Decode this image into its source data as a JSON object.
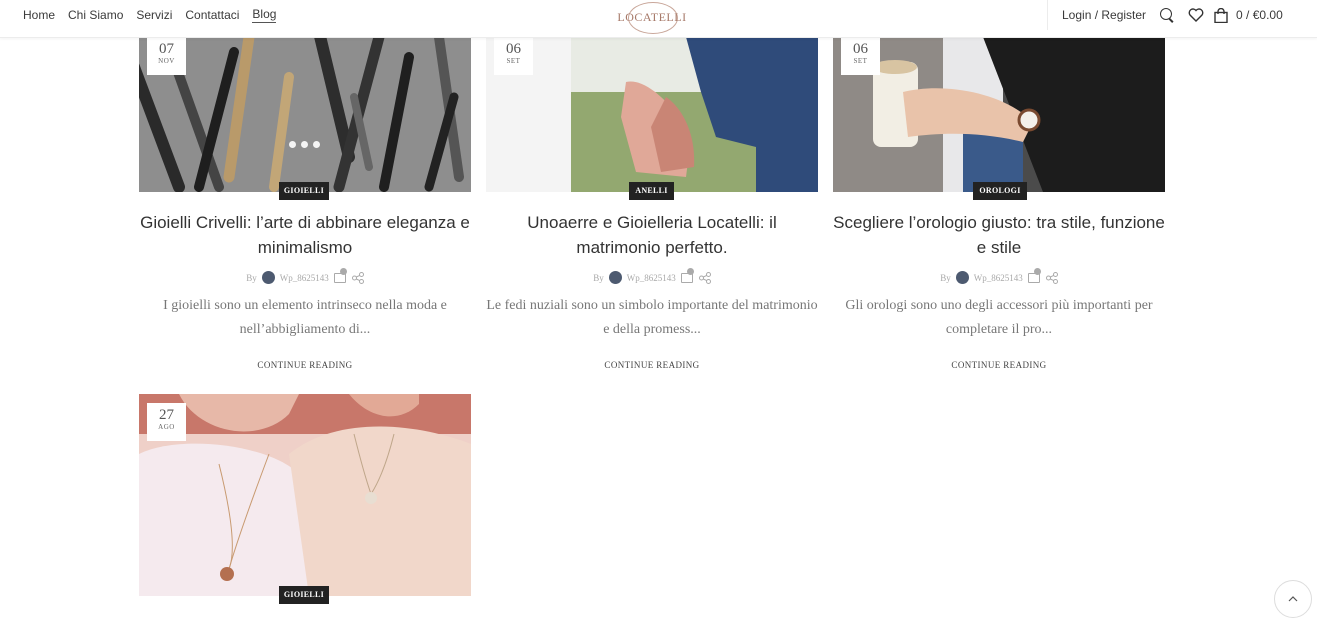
{
  "nav": {
    "items": [
      "Home",
      "Chi Siamo",
      "Servizi",
      "Contattaci",
      "Blog"
    ],
    "active": "Blog"
  },
  "logo": "LOCATELLI",
  "header_right": {
    "login": "Login / Register",
    "cart_total": "0 / €0.00",
    "icons": [
      "search-icon",
      "heart-icon",
      "bag-icon"
    ]
  },
  "posts": [
    {
      "day": "07",
      "month": "NOV",
      "category": "GIOIELLI",
      "title": "Gioielli Crivelli: l’arte di abbinare eleganza e minimalismo",
      "by": "By",
      "author": "Wp_8625143",
      "excerpt": "I gioielli sono un elemento intrinseco nella moda e nell’abbigliamento di...",
      "more": "CONTINUE READING"
    },
    {
      "day": "06",
      "month": "SET",
      "category": "ANELLI",
      "title": "Unoaerre e Gioielleria Locatelli: il matrimonio perfetto.",
      "by": "By",
      "author": "Wp_8625143",
      "excerpt": "Le fedi nuziali sono un simbolo importante del matrimonio e della promess...",
      "more": "CONTINUE READING"
    },
    {
      "day": "06",
      "month": "SET",
      "category": "OROLOGI",
      "title": "Scegliere l’orologio giusto: tra stile, funzione e stile",
      "by": "By",
      "author": "Wp_8625143",
      "excerpt": "Gli orologi sono uno degli accessori più importanti per completare il pro...",
      "more": "CONTINUE READING"
    },
    {
      "day": "27",
      "month": "AGO",
      "category": "GIOIELLI"
    }
  ],
  "colors": {
    "category_badge": "#222222",
    "logo": "#a77a6a"
  }
}
